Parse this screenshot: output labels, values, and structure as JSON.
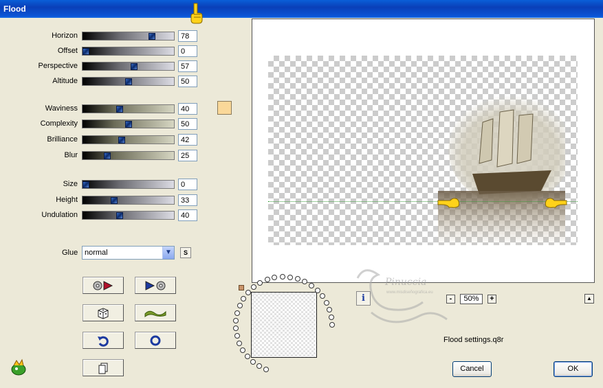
{
  "window": {
    "title": "Flood"
  },
  "sliders": [
    {
      "label": "Horizon",
      "value": "78",
      "fill": 0.78,
      "style": "grey"
    },
    {
      "label": "Offset",
      "value": "0",
      "fill": 0.0,
      "style": "grey"
    },
    {
      "label": "Perspective",
      "value": "57",
      "fill": 0.57,
      "style": "grey"
    },
    {
      "label": "Altitude",
      "value": "50",
      "fill": 0.5,
      "style": "grey"
    },
    {
      "label": "Waviness",
      "value": "40",
      "fill": 0.4,
      "style": "tan"
    },
    {
      "label": "Complexity",
      "value": "50",
      "fill": 0.5,
      "style": "tan"
    },
    {
      "label": "Brilliance",
      "value": "42",
      "fill": 0.42,
      "style": "tan"
    },
    {
      "label": "Blur",
      "value": "25",
      "fill": 0.25,
      "style": "tan"
    },
    {
      "label": "Size",
      "value": "0",
      "fill": 0.0,
      "style": "grey"
    },
    {
      "label": "Height",
      "value": "33",
      "fill": 0.33,
      "style": "grey"
    },
    {
      "label": "Undulation",
      "value": "40",
      "fill": 0.4,
      "style": "grey"
    }
  ],
  "color_swatch": "#fad899",
  "glue": {
    "label": "Glue",
    "value": "normal",
    "s_button": "S"
  },
  "preview": {
    "zoom": "50%",
    "zoom_minus": "-",
    "zoom_plus": "+",
    "info": "i"
  },
  "settings_file": "Flood settings.q8r",
  "watermark": {
    "name": "Pinuccia",
    "url": "www.misdiseñografica.eu"
  },
  "buttons": {
    "cancel": "Cancel",
    "ok": "OK"
  }
}
